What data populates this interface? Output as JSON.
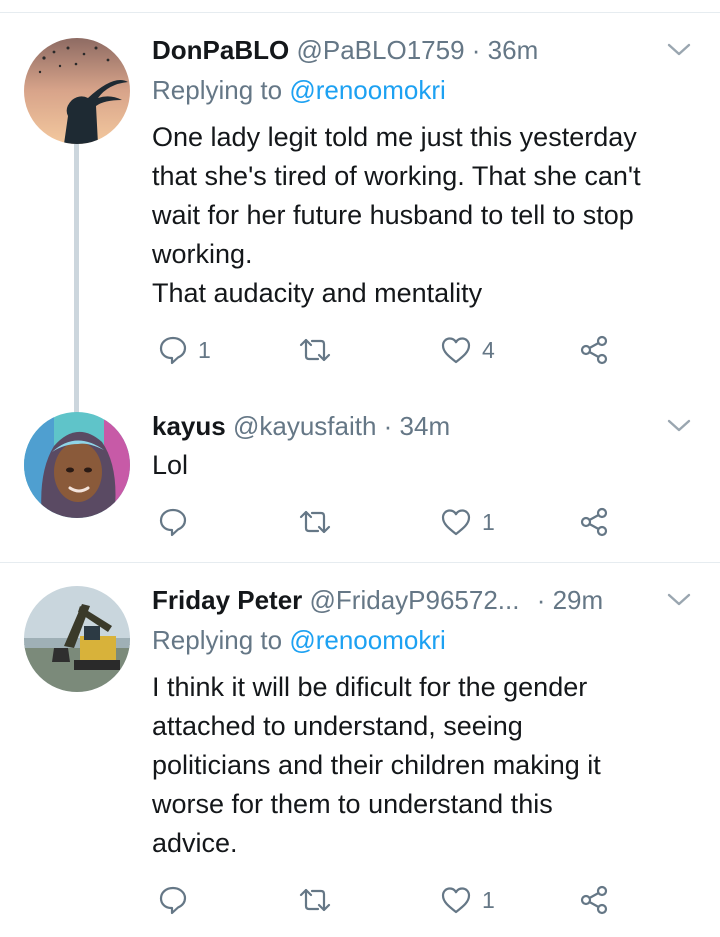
{
  "tweets": [
    {
      "name": "DonPaBLO",
      "handle": "@PaBLO1759",
      "time": "· 36m",
      "replying_label": "Replying to",
      "replying_to": "@renoomokri",
      "text": "One lady legit told me just this yesterday\nthat she's tired of working. That she can't\nwait for her future husband to tell to stop\nworking.\nThat audacity and mentality",
      "replies": "1",
      "retweets": "",
      "likes": "4"
    },
    {
      "name": "kayus",
      "handle": "@kayusfaith",
      "time": "· 34m",
      "text": "Lol",
      "replies": "",
      "retweets": "",
      "likes": "1"
    },
    {
      "name": "Friday Peter",
      "handle": "@FridayP96572...",
      "time": "· 29m",
      "replying_label": "Replying to",
      "replying_to": "@renoomokri",
      "text": "I think it will be dificult for the gender\nattached to understand, seeing\npoliticians and their children making it\nworse for them to understand this\nadvice.",
      "replies": "",
      "retweets": "",
      "likes": "1"
    }
  ],
  "icons": [
    "reply-icon",
    "retweet-icon",
    "like-icon",
    "share-icon",
    "chevron-down-icon"
  ],
  "colors": {
    "link": "#1da1f2",
    "secondary": "#657786",
    "divider": "#e6ecf0",
    "thread_line": "#ccd6dd"
  }
}
